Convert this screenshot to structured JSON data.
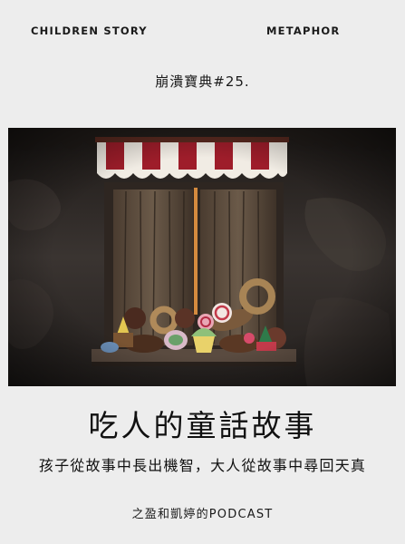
{
  "header": {
    "left_label": "CHILDREN STORY",
    "right_label": "METAPHOR",
    "episode": "崩潰寶典#25."
  },
  "cover": {
    "icon": "candy-window-illustration",
    "awning_colors": [
      "#9e1d2a",
      "#f1ece4"
    ]
  },
  "title": "吃人的童話故事",
  "tagline": "孩子從故事中長出機智，大人從故事中尋回天真",
  "footer": "之盈和凱婷的PODCAST"
}
